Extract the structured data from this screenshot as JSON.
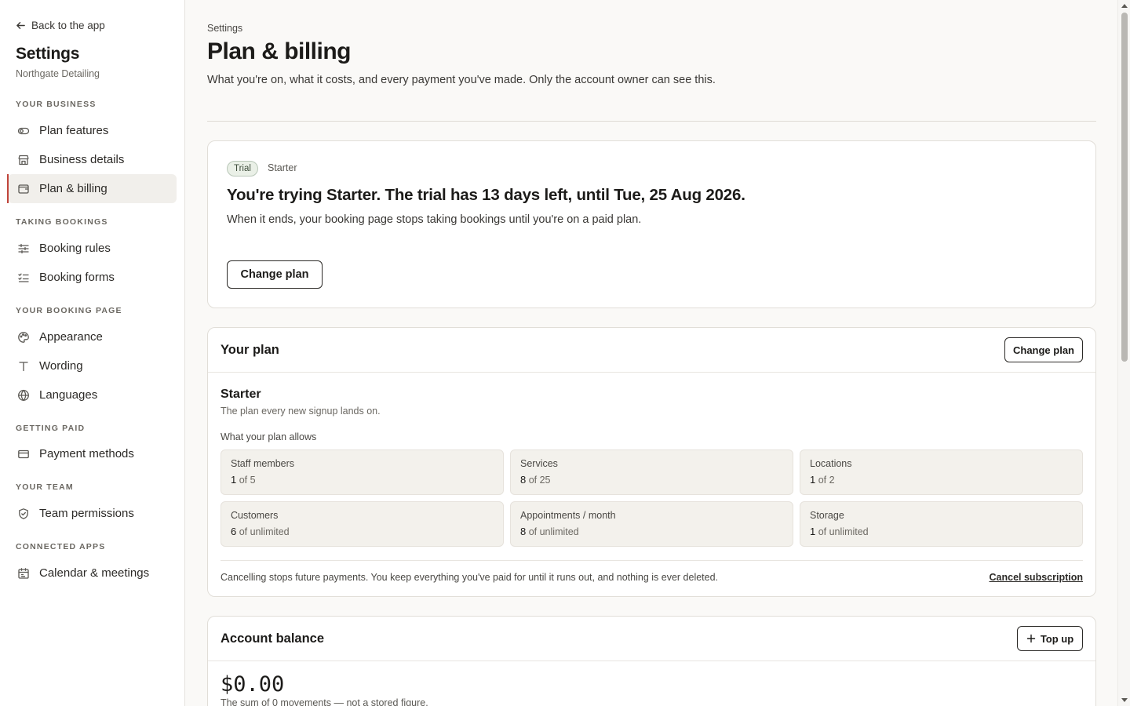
{
  "sidebar": {
    "back_label": "Back to the app",
    "title": "Settings",
    "subtitle": "Northgate Detailing",
    "sections": {
      "your_business": "YOUR BUSINESS",
      "taking_bookings": "TAKING BOOKINGS",
      "your_booking_page": "YOUR BOOKING PAGE",
      "getting_paid": "GETTING PAID",
      "your_team": "YOUR TEAM",
      "connected_apps": "CONNECTED APPS"
    },
    "items": {
      "plan_features": "Plan features",
      "business_details": "Business details",
      "plan_billing": "Plan & billing",
      "booking_rules": "Booking rules",
      "booking_forms": "Booking forms",
      "appearance": "Appearance",
      "wording": "Wording",
      "languages": "Languages",
      "payment_methods": "Payment methods",
      "team_permissions": "Team permissions",
      "calendar_meetings": "Calendar & meetings"
    },
    "active_item": "Plan & billing",
    "accent_color": "#c0443a"
  },
  "header": {
    "breadcrumb": "Settings",
    "title": "Plan & billing",
    "intro": "What you're on, what it costs, and every payment you've made. Only the account owner can see this."
  },
  "trial": {
    "badge": "Trial",
    "plan": "Starter",
    "heading": "You're trying Starter. The trial has 13 days left, until Tue, 25 Aug 2026.",
    "body": "When it ends, your booking page stops taking bookings until you're on a paid plan.",
    "button": "Change plan"
  },
  "plan": {
    "card_title": "Your plan",
    "button": "Change plan",
    "name": "Starter",
    "description": "The plan every new signup lands on.",
    "allows_label": "What your plan allows",
    "limits": [
      {
        "label": "Staff members",
        "used": "1",
        "rest": " of 5"
      },
      {
        "label": "Services",
        "used": "8",
        "rest": " of 25"
      },
      {
        "label": "Locations",
        "used": "1",
        "rest": " of 2"
      },
      {
        "label": "Customers",
        "used": "6",
        "rest": " of unlimited"
      },
      {
        "label": "Appointments / month",
        "used": "8",
        "rest": " of unlimited"
      },
      {
        "label": "Storage",
        "used": "1",
        "rest": " of unlimited"
      }
    ],
    "cancel_note": "Cancelling stops future payments. You keep everything you've paid for until it runs out, and nothing is ever deleted.",
    "cancel_link": "Cancel subscription"
  },
  "balance": {
    "card_title": "Account balance",
    "button": "Top up",
    "value": "$0.00",
    "subtitle": "The sum of 0 movements — not a stored figure."
  }
}
